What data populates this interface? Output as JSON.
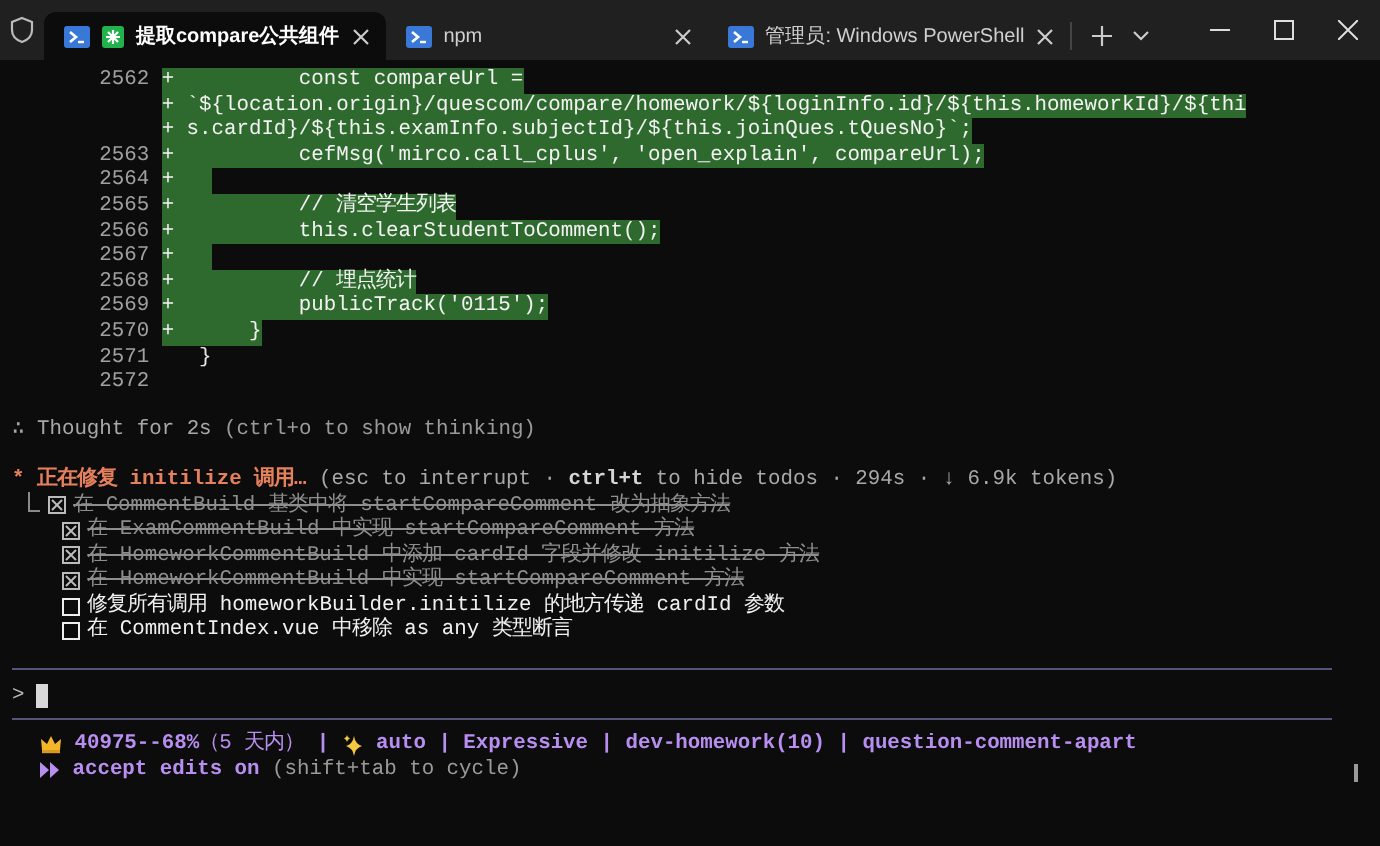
{
  "tabs": [
    {
      "kind": "agent",
      "label": "提取compare公共组件",
      "selected": true
    },
    {
      "kind": "shell",
      "label": "npm",
      "selected": false
    },
    {
      "kind": "shell",
      "label": "管理员: Windows PowerShell",
      "selected": false
    }
  ],
  "diff_lines": [
    {
      "number": "2562",
      "sign": "+",
      "text": "          const compareUrl =",
      "added": true
    },
    {
      "sign": "+",
      "text": " `${location.origin}/quescom/compare/homework/${loginInfo.id}/${this.homeworkId}/${thi",
      "added": true
    },
    {
      "sign": "+",
      "text": " s.cardId}/${this.examInfo.subjectId}/${this.joinQues.tQuesNo}`;",
      "added": true
    },
    {
      "number": "2563",
      "sign": "+",
      "text": "          cefMsg('mirco.call_cplus', 'open_explain', compareUrl);",
      "added": true
    },
    {
      "number": "2564",
      "sign": "+",
      "added": true
    },
    {
      "number": "2565",
      "sign": "+",
      "text": "          // 清空学生列表",
      "added": true
    },
    {
      "number": "2566",
      "sign": "+",
      "text": "          this.clearStudentToComment();",
      "added": true
    },
    {
      "number": "2567",
      "sign": "+",
      "added": true
    },
    {
      "number": "2568",
      "sign": "+",
      "text": "          // 埋点统计",
      "added": true
    },
    {
      "number": "2569",
      "sign": "+",
      "text": "          publicTrack('0115');",
      "added": true
    },
    {
      "number": "2570",
      "sign": "+",
      "text": "      }",
      "added": true
    },
    {
      "number": "2571",
      "text": "  }",
      "added": false
    },
    {
      "number": "2572"
    }
  ],
  "thought": {
    "label": "∴ Thought for 2s",
    "hint": "(ctrl+o to show thinking)"
  },
  "task": {
    "marker": "*",
    "title": "正在修复 initilize 调用…",
    "hint": "(esc to interrupt · **ctrl+t** to hide todos · 294s · ↓ 6.9k tokens)",
    "todos": [
      {
        "text": "在 CommentBuild 基类中将 startCompareComment 改为抽象方法",
        "done": true
      },
      {
        "text": "在 ExamCommentBuild 中实现 startCompareComment 方法",
        "done": true
      },
      {
        "text": "在 HomeworkCommentBuild 中添加 cardId 字段并修改 initilize 方法",
        "done": true
      },
      {
        "text": "在 HomeworkCommentBuild 中实现 startCompareComment 方法",
        "done": true
      },
      {
        "text": "修复所有调用 homeworkBuilder.initilize 的地方传递 cardId 参数",
        "done": false
      },
      {
        "text": "在 CommentIndex.vue 中移除 as any 类型断言",
        "done": false
      }
    ]
  },
  "prompt": {
    "symbol": ">"
  },
  "status_bar": {
    "items": [
      {
        "kind": "quota",
        "text": "**40975--68%**（5 天内） **|**"
      },
      {
        "kind": "mode",
        "text": "**auto | Expressive | dev-homework(10) | question-comment-apart**"
      }
    ]
  },
  "mode": {
    "label": "accept edits on",
    "hint": "(shift+tab to cycle)"
  }
}
